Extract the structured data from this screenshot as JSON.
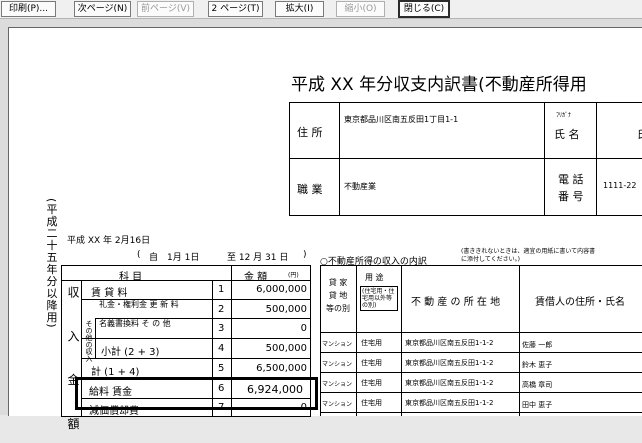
{
  "toolbar": {
    "buttons": [
      {
        "label": "印刷(P)...",
        "enabled": true
      },
      {
        "label": "次ページ(N)",
        "enabled": true
      },
      {
        "label": "前ページ(V)",
        "enabled": false
      },
      {
        "label": "2 ページ(T)",
        "enabled": true
      },
      {
        "label": "拡大(I)",
        "enabled": true
      },
      {
        "label": "縮小(O)",
        "enabled": false
      },
      {
        "label": "閉じる(C)",
        "enabled": true
      }
    ]
  },
  "doc": {
    "title": "平成 XX 年分収支内訳書(不動産所得用",
    "side_text": "(平成二十五年分以降用)",
    "address_label": "住 所",
    "address_value": "東京都品川区南五反田1丁目1-1",
    "furigana_label": "ﾌﾘｶﾞﾅ",
    "name_label": "氏 名",
    "name_partial": "氏",
    "occupation_label": "職 業",
    "occupation_value": "不動産業",
    "phone_label_1": "電 話",
    "phone_label_2": "番 号",
    "phone_value": "1111-22",
    "date": "平成 XX 年  2月16日",
    "period_open": "(",
    "period_from": "自",
    "period_from_date": "1月    1日",
    "period_to": "至 12 月  31 日",
    "period_close": ")",
    "income": {
      "col_item": "科        目",
      "col_amount": "金  額",
      "col_unit": "(円)",
      "group_label": "収 入 金 額",
      "other_label": "その他の収入",
      "rows": [
        {
          "label": "賃 貸 料",
          "no": "1",
          "amount": "6,000,000"
        },
        {
          "label": "礼金・権利金 更   新   料",
          "no": "2",
          "amount": "500,000"
        },
        {
          "label": "名義書換料 そ   の   他",
          "no": "3",
          "amount": "0"
        },
        {
          "label": "小計 (2 + 3)",
          "no": "4",
          "amount": "500,000"
        },
        {
          "label": "計 (1 + 4)",
          "no": "5",
          "amount": "6,500,000"
        },
        {
          "label": "給料  賃金",
          "no": "6",
          "amount": "6,924,000"
        },
        {
          "label": "減価償却費",
          "no": "7",
          "amount": "0"
        }
      ]
    },
    "rental": {
      "heading": "○不動産所得の収入の内訳",
      "note": "(書ききれないときは、適宜の用紙に書いて内容書に添付してください。)",
      "col_type": "貸 家 貸 地 等の別",
      "col_use": "用 途",
      "col_use_sub": "(住宅用・住宅用以外等の別)",
      "col_location": "不 動 産 の 所 在 地",
      "col_tenant": "賃借人の住所・氏名",
      "rows": [
        {
          "type": "マンション",
          "use": "住宅用",
          "location": "東京都品川区南五反田1-1-2",
          "tenant": "佐藤  一郎"
        },
        {
          "type": "マンション",
          "use": "住宅用",
          "location": "東京都品川区南五反田1-1-2",
          "tenant": "鈴木  恵子"
        },
        {
          "type": "マンション",
          "use": "住宅用",
          "location": "東京都品川区南五反田1-1-2",
          "tenant": "高橋  章司"
        },
        {
          "type": "マンション",
          "use": "住宅用",
          "location": "東京都品川区南五反田1-1-2",
          "tenant": "田中  恵子"
        }
      ]
    }
  }
}
